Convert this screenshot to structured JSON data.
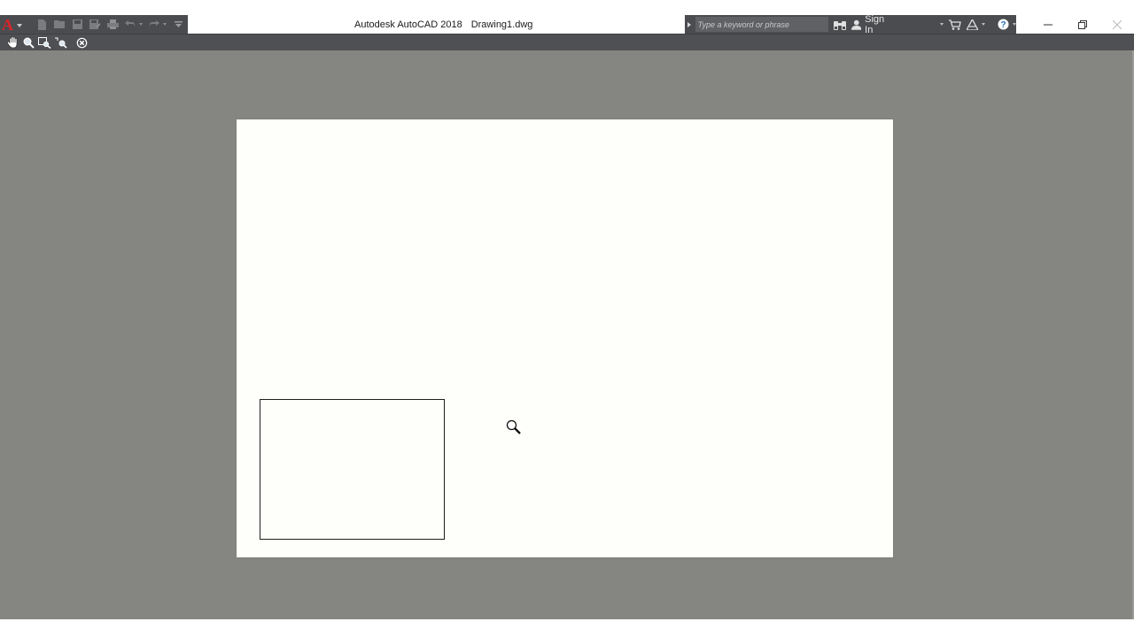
{
  "app": {
    "name": "Autodesk AutoCAD 2018",
    "file": "Drawing1.dwg",
    "logo_letter": "A"
  },
  "search": {
    "placeholder": "Type a keyword or phrase"
  },
  "infocenter": {
    "signin_label": "Sign In"
  },
  "colors": {
    "accent": "#d9252a",
    "toolbar": "#4a4c4f",
    "viewport": "#858681",
    "sheet": "#fefefa"
  },
  "icons": {
    "qat": [
      "new-icon",
      "open-icon",
      "save-icon",
      "save-as-icon",
      "plot-icon",
      "undo-icon",
      "redo-icon",
      "customize-icon"
    ],
    "nav": [
      "pan-icon",
      "zoom-realtime-icon",
      "zoom-window-icon",
      "zoom-previous-icon",
      "exit-icon"
    ]
  }
}
